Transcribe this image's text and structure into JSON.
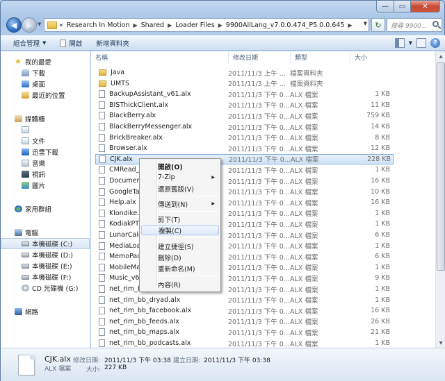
{
  "window": {
    "controls": {
      "minimize": "—",
      "maximize": "▭",
      "close": "✕"
    }
  },
  "address": {
    "prefix": "«",
    "crumbs": [
      "Research In Motion",
      "Shared",
      "Loader Files",
      "9900AllLang_v7.0.0.474_P5.0.0.645"
    ],
    "search_placeholder": "搜尋 9900..."
  },
  "toolbar": {
    "organize": "組合管理",
    "open": "開啟",
    "new_folder": "新增資料夾"
  },
  "navpane": {
    "favorites": "我的最愛",
    "downloads": "下載",
    "desktop": "桌面",
    "recent": "最近的位置",
    "libraries": "媒體櫃",
    "documents": "文件",
    "thunder": "迅雷下載",
    "music": "音樂",
    "videos": "視訊",
    "pictures": "圖片",
    "homegroup": "家用群組",
    "computer": "電腦",
    "drive_c": "本機磁碟 (C:)",
    "drive_d": "本機磁碟 (D:)",
    "drive_e": "本機磁碟 (E:)",
    "drive_f": "本機磁碟 (F:)",
    "drive_g": "CD 光碟機 (G:)",
    "network": "網路"
  },
  "columns": {
    "name": "名稱",
    "date": "修改日期",
    "type": "類型",
    "size": "大小"
  },
  "files": [
    {
      "name": "Java",
      "date": "2011/11/3 上午 ...",
      "type": "檔案資料夾",
      "size": "",
      "folder": true
    },
    {
      "name": "UMTS",
      "date": "2011/11/3 上午 ...",
      "type": "檔案資料夾",
      "size": "",
      "folder": true
    },
    {
      "name": "BackupAssistant_v61.alx",
      "date": "2011/11/3 下午 0...",
      "type": "ALX 檔案",
      "size": "1 KB"
    },
    {
      "name": "BISThickClient.alx",
      "date": "2011/11/3 下午 0...",
      "type": "ALX 檔案",
      "size": "11 KB"
    },
    {
      "name": "BlackBerry.alx",
      "date": "2011/11/3 下午 0...",
      "type": "ALX 檔案",
      "size": "759 KB"
    },
    {
      "name": "BlackBerryMessenger.alx",
      "date": "2011/11/3 下午 0...",
      "type": "ALX 檔案",
      "size": "14 KB"
    },
    {
      "name": "BrickBreaker.alx",
      "date": "2011/11/3 下午 0...",
      "type": "ALX 檔案",
      "size": "8 KB"
    },
    {
      "name": "Browser.alx",
      "date": "2011/11/3 下午 0...",
      "type": "ALX 檔案",
      "size": "12 KB"
    },
    {
      "name": "CJK.alx",
      "date": "2011/11/3 下午 0...",
      "type": "ALX 檔案",
      "size": "228 KB",
      "selected": true
    },
    {
      "name": "CMRead_v",
      "date": "2011/11/3 下午 0...",
      "type": "ALX 檔案",
      "size": "1 KB"
    },
    {
      "name": "Documents",
      "date": "2011/11/3 下午 0...",
      "type": "ALX 檔案",
      "size": "16 KB"
    },
    {
      "name": "GoogleTal",
      "date": "2011/11/3 下午 0...",
      "type": "ALX 檔案",
      "size": "10 KB"
    },
    {
      "name": "Help.alx",
      "date": "2011/11/3 下午 0...",
      "type": "ALX 檔案",
      "size": "16 KB"
    },
    {
      "name": "Klondike.al",
      "date": "2011/11/3 下午 0...",
      "type": "ALX 檔案",
      "size": "1 KB"
    },
    {
      "name": "KodiakPTT",
      "date": "2011/11/3 下午 0...",
      "type": "ALX 檔案",
      "size": "1 KB"
    },
    {
      "name": "LunarCaler",
      "date": "2011/11/3 下午 0...",
      "type": "ALX 檔案",
      "size": "6 KB"
    },
    {
      "name": "MediaLoad",
      "date": "2011/11/3 下午 0...",
      "type": "ALX 檔案",
      "size": "1 KB"
    },
    {
      "name": "MemoPad",
      "date": "2011/11/3 下午 0...",
      "type": "ALX 檔案",
      "size": "6 KB"
    },
    {
      "name": "MobileMa",
      "date": "2011/11/3 下午 0...",
      "type": "ALX 檔案",
      "size": "1 KB"
    },
    {
      "name": "Music_v60.",
      "date": "2011/11/3 下午 0...",
      "type": "ALX 檔案",
      "size": "9 KB"
    },
    {
      "name": "net_rim_bb_",
      "date": "2011/11/3 下午 0...",
      "type": "ALX 檔案",
      "size": "1 KB"
    },
    {
      "name": "net_rim_bb_dryad.alx",
      "date": "2011/11/3 下午 0...",
      "type": "ALX 檔案",
      "size": "1 KB"
    },
    {
      "name": "net_rim_bb_facebook.alx",
      "date": "2011/11/3 下午 0...",
      "type": "ALX 檔案",
      "size": "16 KB"
    },
    {
      "name": "net_rim_bb_feeds.alx",
      "date": "2011/11/3 下午 0...",
      "type": "ALX 檔案",
      "size": "26 KB"
    },
    {
      "name": "net_rim_bb_maps.alx",
      "date": "2011/11/3 下午 0...",
      "type": "ALX 檔案",
      "size": "21 KB"
    },
    {
      "name": "net_rim_bb_podcasts.alx",
      "date": "2011/11/3 下午 0...",
      "type": "ALX 檔案",
      "size": "1 KB"
    }
  ],
  "context_menu": {
    "open": "開啟(O)",
    "sevenzip": "7-Zip",
    "restore": "還原舊版(V)",
    "send_to": "傳送到(N)",
    "cut": "剪下(T)",
    "copy": "複製(C)",
    "shortcut": "建立捷徑(S)",
    "delete": "刪除(D)",
    "rename": "重新命名(M)",
    "properties": "內容(R)"
  },
  "details": {
    "name": "CJK.alx",
    "type": "ALX 檔案",
    "modified_label": "修改日期:",
    "modified_value": "2011/11/3 下午 03:38",
    "created_label": "建立日期:",
    "created_value": "2011/11/3 下午 03:38",
    "size_label": "大小:",
    "size_value": "227 KB"
  }
}
